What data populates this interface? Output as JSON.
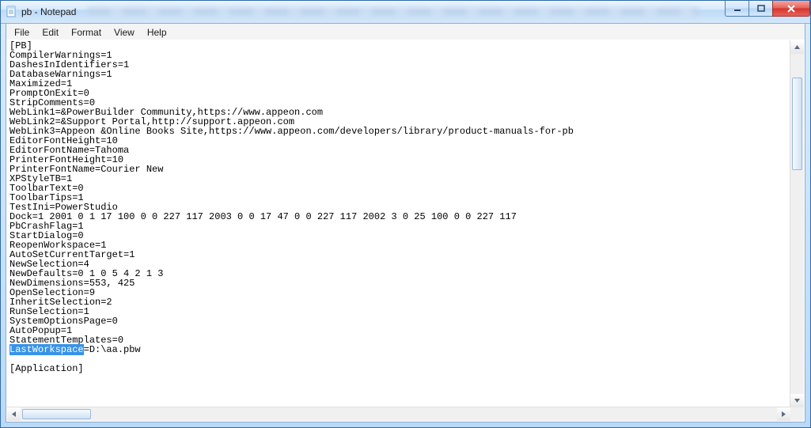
{
  "window": {
    "title": "pb - Notepad"
  },
  "menu": {
    "file": "File",
    "edit": "Edit",
    "format": "Format",
    "view": "View",
    "help": "Help"
  },
  "selection": {
    "text": "LastWorkspace"
  },
  "content": {
    "before_selection": "[PB]\nCompilerWarnings=1\nDashesInIdentifiers=1\nDatabaseWarnings=1\nMaximized=1\nPromptOnExit=0\nStripComments=0\nWebLink1=&PowerBuilder Community,https://www.appeon.com\nWebLink2=&Support Portal,http://support.appeon.com\nWebLink3=Appeon &Online Books Site,https://www.appeon.com/developers/library/product-manuals-for-pb\nEditorFontHeight=10\nEditorFontName=Tahoma\nPrinterFontHeight=10\nPrinterFontName=Courier New\nXPStyleTB=1\nToolbarText=0\nToolbarTips=1\nTestIni=PowerStudio\nDock=1 2001 0 1 17 100 0 0 227 117 2003 0 0 17 47 0 0 227 117 2002 3 0 25 100 0 0 227 117\nPbCrashFlag=1\nStartDialog=0\nReopenWorkspace=1\nAutoSetCurrentTarget=1\nNewSelection=4\nNewDefaults=0 1 0 5 4 2 1 3\nNewDimensions=553, 425\nOpenSelection=9\nInheritSelection=2\nRunSelection=1\nSystemOptionsPage=0\nAutoPopup=1\nStatementTemplates=0\n",
    "after_selection": "=D:\\aa.pbw\n\n[Application]"
  }
}
